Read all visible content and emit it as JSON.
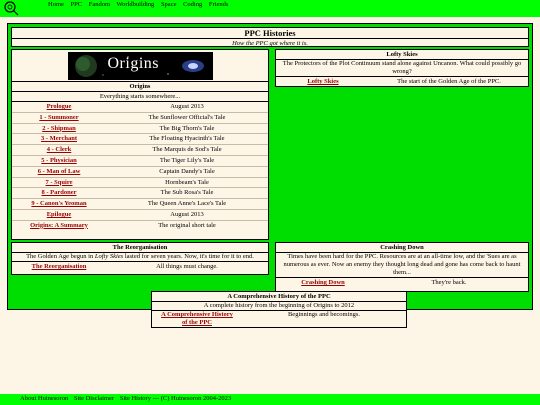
{
  "nav": [
    "Home",
    "PPC",
    "Fandom",
    "Worldbuilding",
    "Space",
    "Coding",
    "Friends"
  ],
  "title": "PPC Histories",
  "subtitle": "How the PPC got where it is.",
  "origins": {
    "banner": "Origins",
    "heading": "Origins",
    "tagline": "Everything starts somewhere...",
    "rows": [
      {
        "link": "Prologue",
        "desc": "August 2013"
      },
      {
        "link": "1 - Summoner",
        "desc": "The Sunflower Official's Tale"
      },
      {
        "link": "2 - Shipman",
        "desc": "The Big Thorn's Tale"
      },
      {
        "link": "3 - Merchant",
        "desc": "The Floating Hyacinth's Tale"
      },
      {
        "link": "4 - Clerk",
        "desc": "The Marquis de Sod's Tale"
      },
      {
        "link": "5 - Physician",
        "desc": "The Tiger Lily's Tale"
      },
      {
        "link": "6 - Man of Law",
        "desc": "Captain Dandy's Tale"
      },
      {
        "link": "7 - Squire",
        "desc": "Hornbeam's Tale"
      },
      {
        "link": "8 - Pardoner",
        "desc": "The Sub Rosa's Tale"
      },
      {
        "link": "9 - Canon's Yeoman",
        "desc": "The Queen Anne's Lace's Tale"
      },
      {
        "link": "Epilogue",
        "desc": "August 2013"
      },
      {
        "link": "Origins: A Summary",
        "desc": "The original short tale"
      }
    ]
  },
  "lofty": {
    "heading": "Lofty Skies",
    "desc": "The Protectors of the Plot Continuum stand alone against Uncanon. What could possibly go wrong?",
    "link": "Lofty Skies",
    "note": "The start of the Golden Age of the PPC."
  },
  "reorg": {
    "heading": "The Reorganisation",
    "desc_pre": "The Golden Age begun in ",
    "desc_em": "Lofty Skies",
    "desc_post": " lasted for seven years. Now, it's time for it to end.",
    "link": "The Reorganisation",
    "note": "All things must change."
  },
  "crash": {
    "heading": "Crashing Down",
    "desc": "Times have been hard for the PPC. Resources are at an all-time low, and the 'Sues are as numerous as ever. Now an enemy they thought long dead and gone has come back to haunt them...",
    "link": "Crashing Down",
    "note": "They're back."
  },
  "compr": {
    "heading": "A Comprehensive History of the PPC",
    "desc": "A complete history from the beginning of Origins to 2012",
    "link1": "A Comprehensive History",
    "link2": "of the PPC",
    "note": "Beginnings and becomings."
  },
  "footer": {
    "about": "About Huinesoron",
    "disclaimer": "Site Disclaimer",
    "history": "Site History --- (C) Huinesoron 2004-2023"
  },
  "colors": {
    "green": "#00ff00",
    "frame": "#00dd00",
    "cream": "#fdf5e6",
    "link": "#990000"
  }
}
